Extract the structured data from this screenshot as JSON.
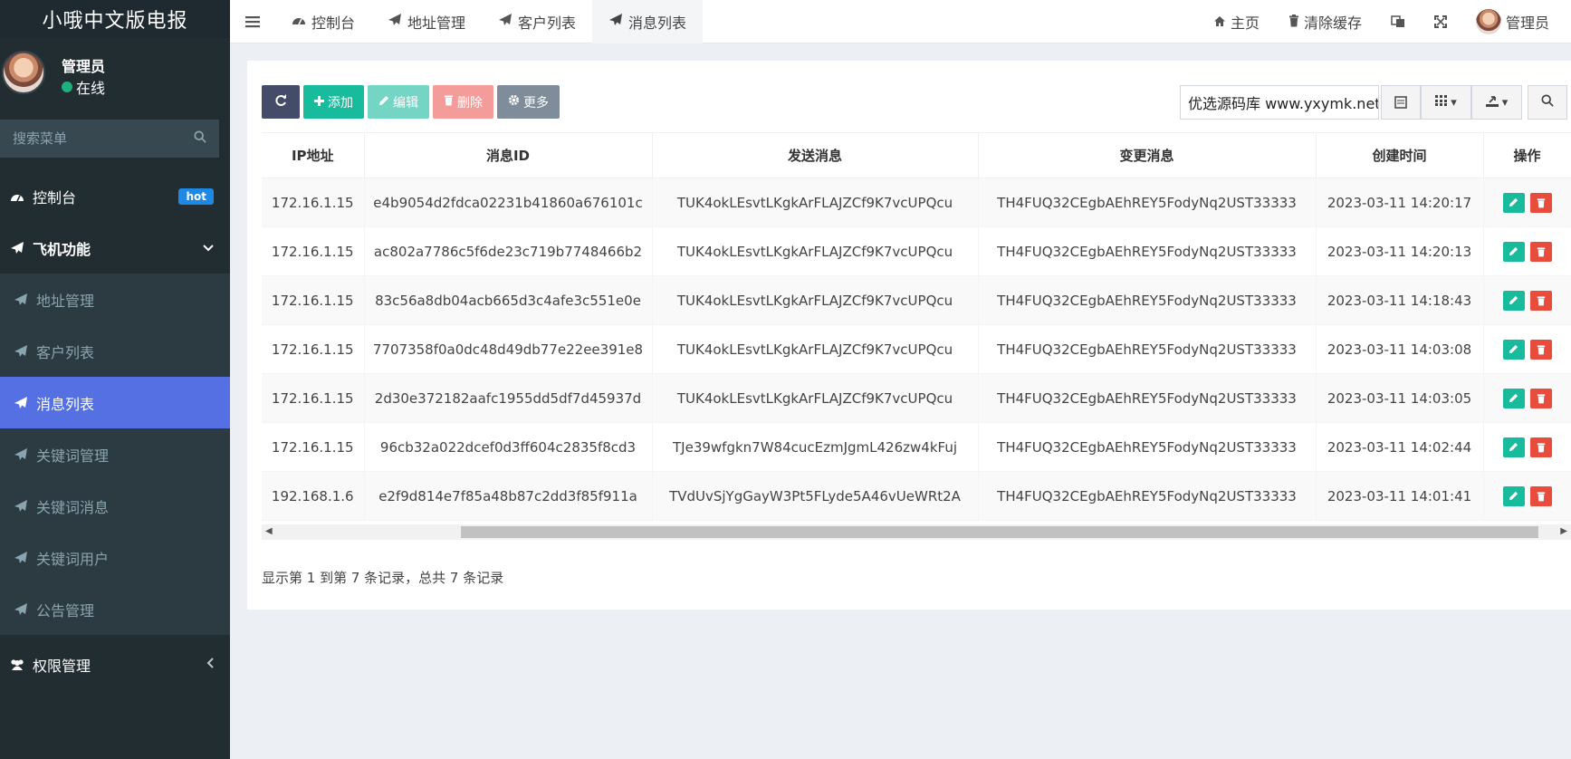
{
  "sidebar": {
    "logo": "小哦中文版电报",
    "user": {
      "name": "管理员",
      "status": "在线"
    },
    "search_placeholder": "搜索菜单",
    "items": [
      {
        "label": "控制台",
        "badge": "hot",
        "icon": "dashboard-icon"
      },
      {
        "label": "飞机功能",
        "icon": "paper-plane-icon"
      },
      {
        "label": "地址管理",
        "icon": "paper-plane-icon"
      },
      {
        "label": "客户列表",
        "icon": "paper-plane-icon"
      },
      {
        "label": "消息列表",
        "icon": "paper-plane-icon",
        "active": true
      },
      {
        "label": "关键词管理",
        "icon": "paper-plane-icon"
      },
      {
        "label": "关键词消息",
        "icon": "paper-plane-icon"
      },
      {
        "label": "关键词用户",
        "icon": "paper-plane-icon"
      },
      {
        "label": "公告管理",
        "icon": "paper-plane-icon"
      },
      {
        "label": "权限管理",
        "icon": "users-icon"
      }
    ]
  },
  "topbar": {
    "tabs": [
      "控制台",
      "地址管理",
      "客户列表",
      "消息列表"
    ],
    "right": {
      "home": "主页",
      "clear_cache": "清除缓存",
      "user": "管理员"
    }
  },
  "toolbar": {
    "add": "添加",
    "edit": "编辑",
    "delete": "删除",
    "more": "更多"
  },
  "search": {
    "value": "优选源码库 www.yxymk.net"
  },
  "table": {
    "headers": [
      "IP地址",
      "消息ID",
      "发送消息",
      "变更消息",
      "创建时间",
      "操作"
    ],
    "rows": [
      [
        "172.16.1.15",
        "e4b9054d2fdca02231b41860a676101c",
        "TUK4okLEsvtLKgkArFLAJZCf9K7vcUPQcu",
        "TH4FUQ32CEgbAEhREY5FodyNq2UST33333",
        "2023-03-11 14:20:17"
      ],
      [
        "172.16.1.15",
        "ac802a7786c5f6de23c719b7748466b2",
        "TUK4okLEsvtLKgkArFLAJZCf9K7vcUPQcu",
        "TH4FUQ32CEgbAEhREY5FodyNq2UST33333",
        "2023-03-11 14:20:13"
      ],
      [
        "172.16.1.15",
        "83c56a8db04acb665d3c4afe3c551e0e",
        "TUK4okLEsvtLKgkArFLAJZCf9K7vcUPQcu",
        "TH4FUQ32CEgbAEhREY5FodyNq2UST33333",
        "2023-03-11 14:18:43"
      ],
      [
        "172.16.1.15",
        "7707358f0a0dc48d49db77e22ee391e8",
        "TUK4okLEsvtLKgkArFLAJZCf9K7vcUPQcu",
        "TH4FUQ32CEgbAEhREY5FodyNq2UST33333",
        "2023-03-11 14:03:08"
      ],
      [
        "172.16.1.15",
        "2d30e372182aafc1955dd5df7d45937d",
        "TUK4okLEsvtLKgkArFLAJZCf9K7vcUPQcu",
        "TH4FUQ32CEgbAEhREY5FodyNq2UST33333",
        "2023-03-11 14:03:05"
      ],
      [
        "172.16.1.15",
        "96cb32a022dcef0d3ff604c2835f8cd3",
        "TJe39wfgkn7W84cucEzmJgmL426zw4kFuj",
        "TH4FUQ32CEgbAEhREY5FodyNq2UST33333",
        "2023-03-11 14:02:44"
      ],
      [
        "192.168.1.6",
        "e2f9d814e7f85a48b87c2dd3f85f911a",
        "TVdUvSjYgGayW3Pt5FLyde5A46vUeWRt2A",
        "TH4FUQ32CEgbAEhREY5FodyNq2UST33333",
        "2023-03-11 14:01:41"
      ]
    ]
  },
  "pager": {
    "summary": "显示第 1 到第 7 条记录，总共 7 条记录"
  },
  "colors": {
    "accent": "#18bc9c",
    "active_nav": "#5470e2",
    "sidebar_bg": "#222d32",
    "danger": "#e74c3c"
  }
}
